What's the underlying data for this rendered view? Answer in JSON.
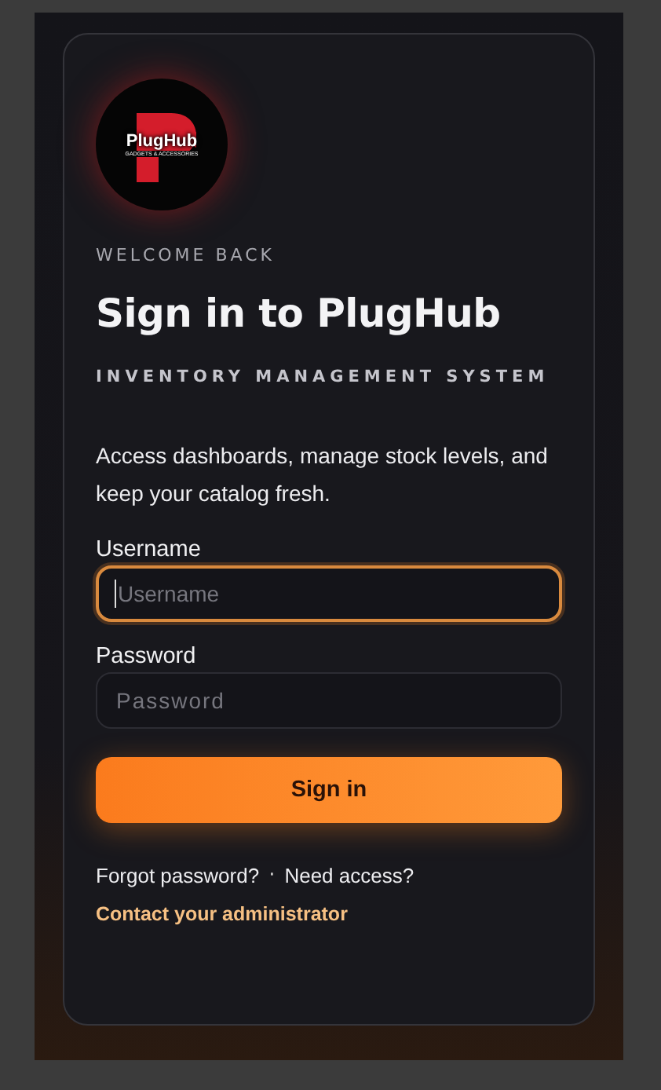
{
  "logo": {
    "name": "PlugHub",
    "tagline": "GADGETS & ACCESSORIES"
  },
  "eyebrow": "WELCOME BACK",
  "title": "Sign in to PlugHub",
  "subtitle": "INVENTORY MANAGEMENT SYSTEM",
  "description": "Access dashboards, manage stock levels, and keep your catalog fresh.",
  "fields": [
    {
      "label": "Username",
      "placeholder": "Username",
      "focused": true,
      "kind": "plain"
    },
    {
      "label": "Password",
      "placeholder": "Password",
      "focused": false,
      "kind": "secret"
    }
  ],
  "submit": "Sign in",
  "links": [
    {
      "label": "Forgot password?"
    },
    {
      "label": "Need access?"
    }
  ],
  "separator": "·",
  "contact": "Contact your administrator"
}
